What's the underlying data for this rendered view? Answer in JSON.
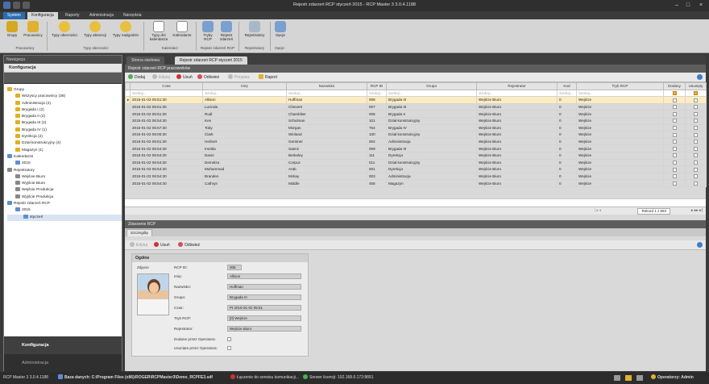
{
  "window": {
    "title": "Rejestr zdarzeń RCP styczeń 2015 - RCP Master 3 3.0.4.1188"
  },
  "menu": [
    "System",
    "Konfiguracja",
    "Raporty",
    "Administracja",
    "Narzędzia"
  ],
  "ribbon": {
    "buttons": [
      "Grupy",
      "Pracownicy",
      "Typy obecności",
      "Typy absencji",
      "Typy nadgodzin",
      "Typy dni kalendarza",
      "Kalendarze",
      "Tryby RCP",
      "Rejestr zdarzeń",
      "Rejestratory",
      "Opcje"
    ],
    "groups": [
      "Pracownicy",
      "Typy obecności",
      "Kalendarz",
      "Rejestr zdarzeń RCP",
      "Rejestratory",
      "Opcje"
    ]
  },
  "nav": {
    "header": "Nawigacja",
    "title": "Konfiguracja",
    "tree": [
      {
        "label": "Grupy",
        "level": 0,
        "color": "#e0b020"
      },
      {
        "label": "Wszyscy pracownicy (36)",
        "level": 1,
        "color": "#e0b020"
      },
      {
        "label": "Administracja (2)",
        "level": 1,
        "color": "#e0b020"
      },
      {
        "label": "Brygada I (2)",
        "level": 1,
        "color": "#e0b020"
      },
      {
        "label": "Brygada II (2)",
        "level": 1,
        "color": "#e0b020"
      },
      {
        "label": "Brygada III (2)",
        "level": 1,
        "color": "#e0b020"
      },
      {
        "label": "Brygada IV (1)",
        "level": 1,
        "color": "#e0b020"
      },
      {
        "label": "Dyrekcja (2)",
        "level": 1,
        "color": "#e0b020"
      },
      {
        "label": "Dział konstrukcyjny (4)",
        "level": 1,
        "color": "#e0b020"
      },
      {
        "label": "Magazyn (1)",
        "level": 1,
        "color": "#e0b020"
      },
      {
        "label": "Kalendarze",
        "level": 0,
        "color": "#5a8fd0"
      },
      {
        "label": "2015",
        "level": 1,
        "color": "#5a8fd0"
      },
      {
        "label": "Rejestratory",
        "level": 0,
        "color": "#888888"
      },
      {
        "label": "Wejście Biuro",
        "level": 1,
        "color": "#888888"
      },
      {
        "label": "Wyjście Biuro",
        "level": 1,
        "color": "#888888"
      },
      {
        "label": "Wejście Produkcja",
        "level": 1,
        "color": "#888888"
      },
      {
        "label": "Wyjście Produkcja",
        "level": 1,
        "color": "#888888"
      },
      {
        "label": "Rejestr zdarzeń RCP",
        "level": 0,
        "color": "#5a8fd0"
      },
      {
        "label": "2015",
        "level": 1,
        "color": "#5a8fd0"
      },
      {
        "label": "styczeń",
        "level": 2,
        "color": "#5a8fd0"
      }
    ],
    "bottom": [
      "Konfiguracja",
      "Administracja"
    ]
  },
  "tabs": [
    "Strona startowa",
    "Rejestr zdarzeń RCP styczeń 2015"
  ],
  "grid": {
    "section_title": "Rejestr zdarzeń RCP pracowników",
    "toolbar": {
      "add": "Dodaj",
      "edit": "Edytuj",
      "delete": "Usuń",
      "refresh": "Odśwież",
      "reassign": "Przypisz",
      "report": "Raport"
    },
    "columns": [
      "Czas",
      "Imię",
      "Nazwisko",
      "RCP ID",
      "Grupa",
      "Rejestrator",
      "Kod",
      "Tryb RCP",
      "Dodany",
      "Usunięty"
    ],
    "filter": "Szukaj...",
    "rows": [
      [
        "2015-01-02 05:51:30",
        "Allison",
        "Huffman",
        "008",
        "Brygada III",
        "Wejście Biuro",
        "0",
        "Wejście"
      ],
      [
        "2015-01-02 05:51:30",
        "Lucinda",
        "Chevere",
        "007",
        "Brygada III",
        "Wejście Biuro",
        "0",
        "Wejście"
      ],
      [
        "2015-01-02 05:51:30",
        "Rudi",
        "Chambliss",
        "006",
        "Brygada II",
        "Wejście Biuro",
        "0",
        "Wejście"
      ],
      [
        "2015-01-02 06:54:30",
        "Ken",
        "Schulman",
        "101",
        "Dział konstrukcyjny",
        "Wejście Biuro",
        "0",
        "Wejście"
      ],
      [
        "2015-01-02 05:57:30",
        "Toby",
        "Morgan",
        "754",
        "Brygada IV",
        "Wejście Biuro",
        "0",
        "Wejście"
      ],
      [
        "2015-01-02 06:00:30",
        "Clark",
        "Winland",
        "100",
        "Dział konstrukcyjny",
        "Wejście Biuro",
        "0",
        "Wejście"
      ],
      [
        "2015-01-02 06:51:30",
        "Herbert",
        "Gerstner",
        "002",
        "Administracja",
        "Wejście Biuro",
        "0",
        "Wejście"
      ],
      [
        "2015-01-02 06:54:30",
        "Imelda",
        "Saenz",
        "009",
        "Brygada III",
        "Wejście Biuro",
        "0",
        "Wejście"
      ],
      [
        "2015-01-02 06:54:30",
        "Davis",
        "Berkeley",
        "111",
        "Dyrekcja",
        "Wejście Biuro",
        "0",
        "Wejście"
      ],
      [
        "2015-01-02 06:54:30",
        "Demelza",
        "Corpuz",
        "011",
        "Dział konstrukcyjny",
        "Wejście Biuro",
        "0",
        "Wejście"
      ],
      [
        "2015-01-02 06:54:30",
        "Muhammad",
        "Arab",
        "001",
        "Dyrekcja",
        "Wejście Biuro",
        "0",
        "Wejście"
      ],
      [
        "2015-01-02 06:54:30",
        "Branden",
        "Mckay",
        "003",
        "Administracja",
        "Wejście Biuro",
        "0",
        "Wejście"
      ],
      [
        "2015-01-02 06:54:30",
        "Cathryn",
        "Middle",
        "456",
        "Magazyn",
        "Wejście Biuro",
        "0",
        "Wejście"
      ]
    ],
    "record": "Rekord 1 z 663"
  },
  "event": {
    "section_title": "Zdarzenie RCP",
    "subtab": "Szczegóły",
    "toolbar": {
      "edit": "Edytuj",
      "delete": "Usuń",
      "refresh": "Odśwież"
    },
    "group": "Ogólne",
    "photo_label": "Zdjęcie",
    "labels": [
      "RCP ID:",
      "Imię:",
      "Nazwisko:",
      "Grupa:",
      "Czas:",
      "Tryb RCP:",
      "Rejestrator:",
      "Dodane przez Operatora:",
      "Usunięte przez Operatora:"
    ],
    "values": [
      "008",
      "Allison",
      "Huffman",
      "Brygada III",
      "Pt 2015-01-02 05:51",
      "[0] Wejście",
      "Wejście Biuro"
    ]
  },
  "status": {
    "version": "RCP Master 3 3.0.4.1188",
    "db": "Baza danych: C:\\Program Files (x86)\\ROGER\\RCPMaster3\\Demo_RCPFE3.sdf",
    "comm": "Łączenie do serwisu komunikacji...",
    "server": "Serwer licencji: 192.168.0.172:8891",
    "operator": "Operatorzy: Admin"
  },
  "colors": {
    "accent": "#2b6cb0",
    "highlight_row": "#fdecbf"
  }
}
